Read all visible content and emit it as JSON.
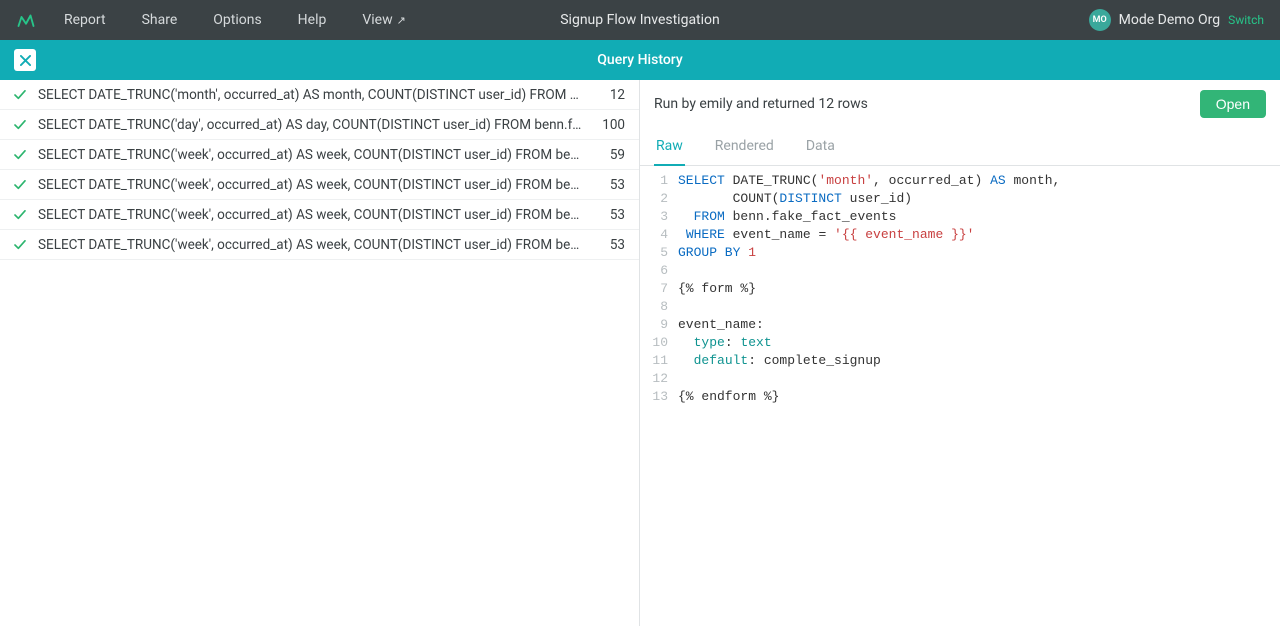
{
  "nav": {
    "items": [
      "Report",
      "Share",
      "Options",
      "Help",
      "View"
    ],
    "view_has_arrow": true,
    "page_title": "Signup Flow Investigation",
    "org_badge": "MO",
    "org_name": "Mode Demo Org",
    "switch_label": "Switch"
  },
  "subheader": {
    "title": "Query History"
  },
  "history": [
    {
      "status": "success",
      "query": "SELECT DATE_TRUNC('month', occurred_at) AS month, COUNT(DISTINCT user_id) FROM ben…",
      "rows": "12"
    },
    {
      "status": "success",
      "query": "SELECT DATE_TRUNC('day', occurred_at) AS day, COUNT(DISTINCT user_id) FROM benn.f…",
      "rows": "100"
    },
    {
      "status": "success",
      "query": "SELECT DATE_TRUNC('week', occurred_at) AS week, COUNT(DISTINCT user_id) FROM benn…",
      "rows": "59"
    },
    {
      "status": "success",
      "query": "SELECT DATE_TRUNC('week', occurred_at) AS week, COUNT(DISTINCT user_id) FROM benn…",
      "rows": "53"
    },
    {
      "status": "success",
      "query": "SELECT DATE_TRUNC('week', occurred_at) AS week, COUNT(DISTINCT user_id) FROM benn…",
      "rows": "53"
    },
    {
      "status": "success",
      "query": "SELECT DATE_TRUNC('week', occurred_at) AS week, COUNT(DISTINCT user_id) FROM benn…",
      "rows": "53"
    }
  ],
  "detail": {
    "run_info": "Run by emily and returned 12 rows",
    "open_label": "Open",
    "tabs": [
      "Raw",
      "Rendered",
      "Data"
    ],
    "active_tab": 0,
    "code": {
      "tokens": [
        [
          {
            "t": "SELECT",
            "c": "k-blue"
          },
          {
            "t": " DATE_TRUNC("
          },
          {
            "t": "'month'",
            "c": "k-red"
          },
          {
            "t": ", occurred_at) "
          },
          {
            "t": "AS",
            "c": "k-blue"
          },
          {
            "t": " month,"
          }
        ],
        [
          {
            "t": "       COUNT("
          },
          {
            "t": "DISTINCT",
            "c": "k-blue"
          },
          {
            "t": " user_id)"
          }
        ],
        [
          {
            "t": "  "
          },
          {
            "t": "FROM",
            "c": "k-blue"
          },
          {
            "t": " benn.fake_fact_events"
          }
        ],
        [
          {
            "t": " "
          },
          {
            "t": "WHERE",
            "c": "k-blue"
          },
          {
            "t": " event_name = "
          },
          {
            "t": "'{{ event_name }}'",
            "c": "k-red"
          }
        ],
        [
          {
            "t": "GROUP BY",
            "c": "k-blue"
          },
          {
            "t": " "
          },
          {
            "t": "1",
            "c": "k-num"
          }
        ],
        [
          {
            "t": ""
          }
        ],
        [
          {
            "t": "{% form %}"
          }
        ],
        [
          {
            "t": ""
          }
        ],
        [
          {
            "t": "event_name:"
          }
        ],
        [
          {
            "t": "  "
          },
          {
            "t": "type",
            "c": "k-teal"
          },
          {
            "t": ": "
          },
          {
            "t": "text",
            "c": "k-teal"
          }
        ],
        [
          {
            "t": "  "
          },
          {
            "t": "default",
            "c": "k-teal"
          },
          {
            "t": ": complete_signup"
          }
        ],
        [
          {
            "t": ""
          }
        ],
        [
          {
            "t": "{% endform %}"
          }
        ]
      ]
    }
  }
}
